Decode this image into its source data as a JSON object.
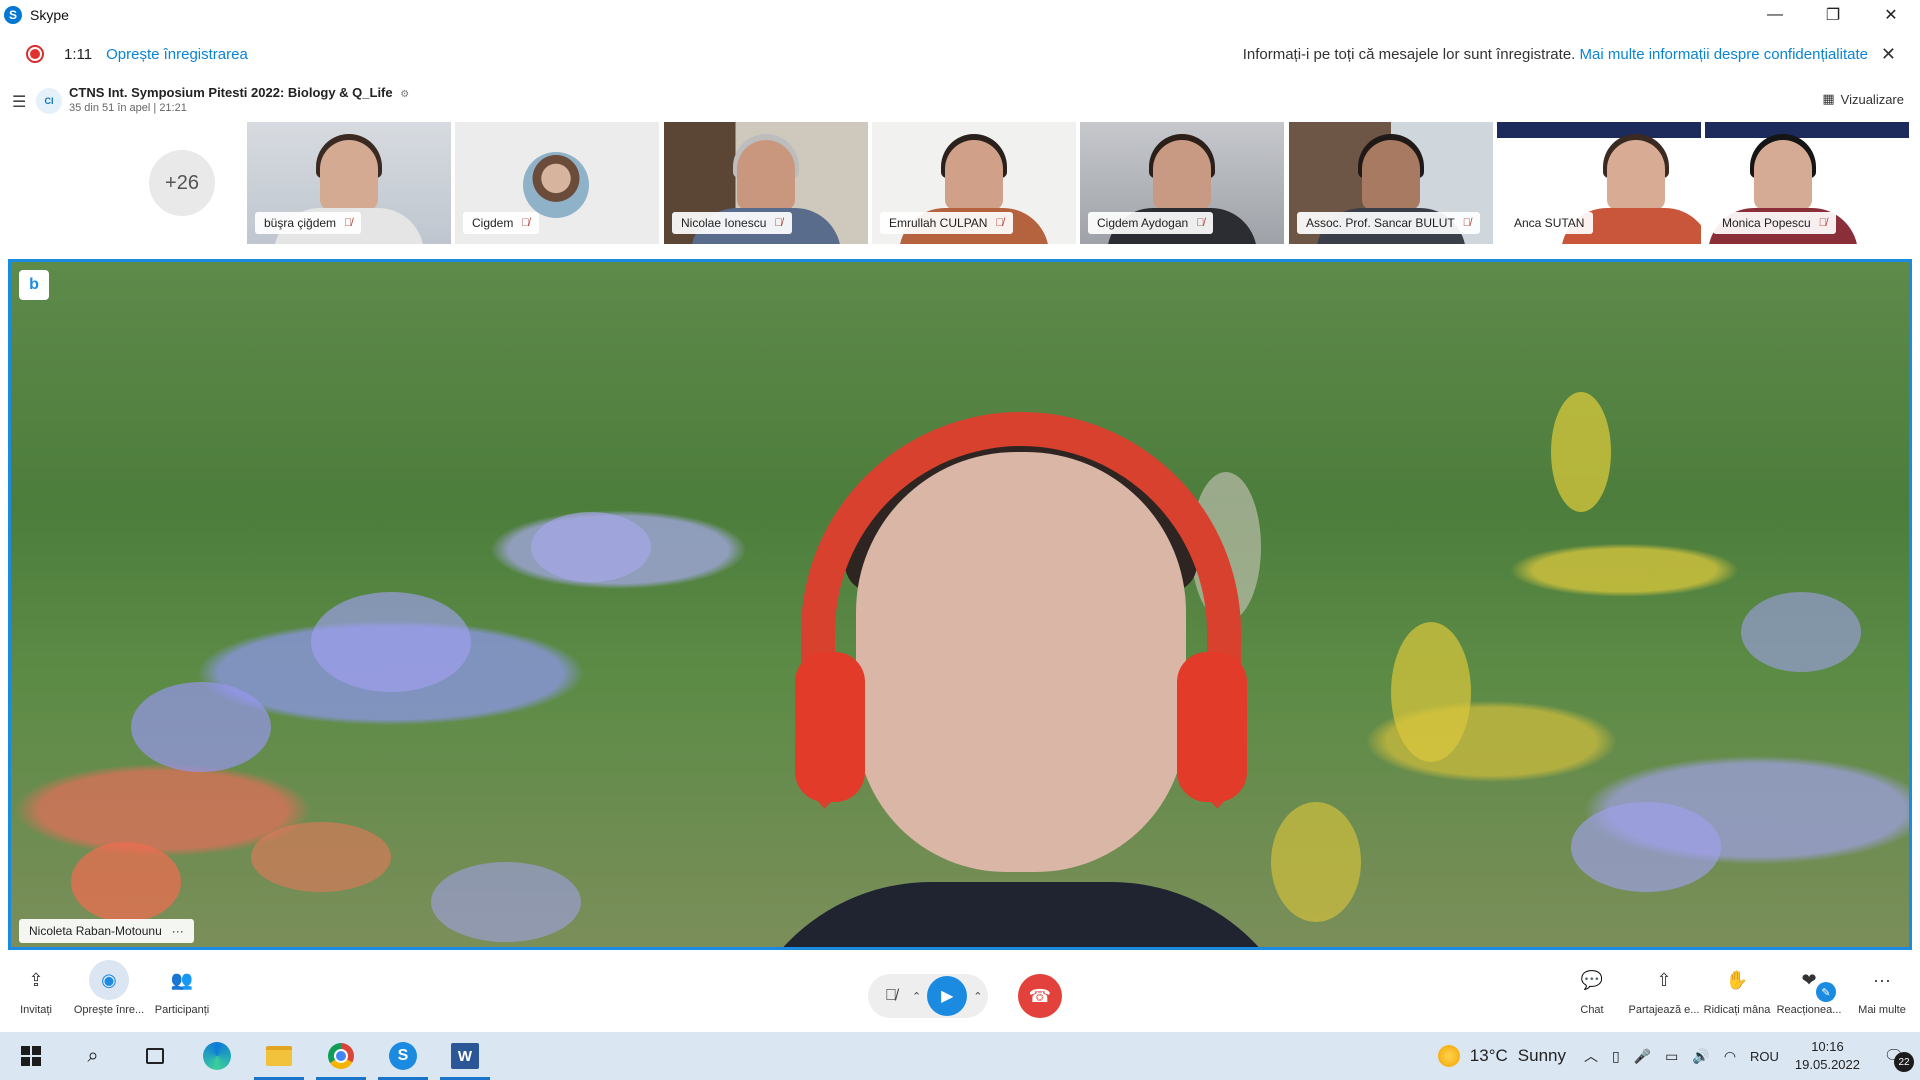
{
  "app": {
    "title": "Skype"
  },
  "window_controls": {
    "minimize": "—",
    "maximize": "❐",
    "close": "✕"
  },
  "recording": {
    "time": "1:11",
    "stop_label": "Oprește înregistrarea",
    "notice": "Informați-i pe toți că mesajele lor sunt înregistrate.",
    "privacy_link": "Mai multe informații despre confidențialitate"
  },
  "conversation": {
    "avatar_initials": "CI",
    "title": "CTNS Int. Symposium Pitesti 2022: Biology & Q_Life",
    "subtitle": "35 din 51 în apel | 21:21",
    "view_label": "Vizualizare"
  },
  "participants": {
    "overflow": "+26",
    "tiles": [
      {
        "name": "büşra çiğdem"
      },
      {
        "name": "Cigdem"
      },
      {
        "name": "Nicolae Ionescu"
      },
      {
        "name": "Emrullah CULPAN"
      },
      {
        "name": "Cigdem Aydogan"
      },
      {
        "name": "Assoc. Prof. Sancar BULUT"
      },
      {
        "name": "Anca SUTAN"
      },
      {
        "name": "Monica Popescu"
      }
    ]
  },
  "main_video": {
    "speaker": "Nicoleta Raban-Motounu",
    "badge": "b"
  },
  "controls": {
    "invite": "Invitați",
    "stop_recording": "Oprește înre...",
    "participants": "Participanți",
    "chat": "Chat",
    "share": "Partajează e...",
    "raise_hand": "Ridicați mâna",
    "react": "Reacționea...",
    "more": "Mai multe"
  },
  "taskbar": {
    "weather_temp": "13°C",
    "weather_text": "Sunny",
    "language": "ROU",
    "time": "10:16",
    "date": "19.05.2022",
    "notification_count": "22"
  }
}
